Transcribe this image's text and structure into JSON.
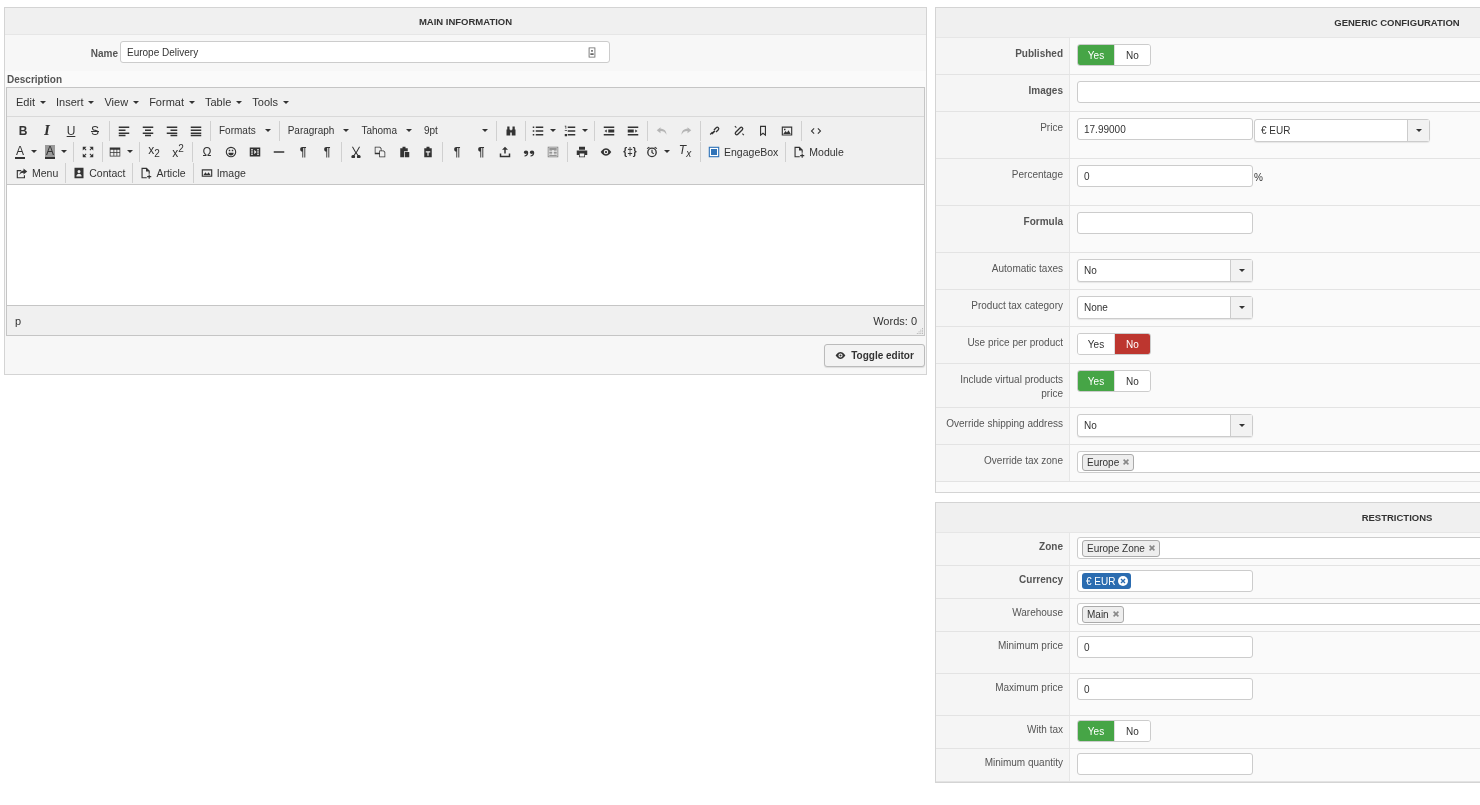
{
  "main": {
    "title": "MAIN INFORMATION",
    "name": {
      "label": "Name",
      "value": "Europe Delivery"
    },
    "description_label": "Description",
    "editor": {
      "menus": [
        "Edit",
        "Insert",
        "View",
        "Format",
        "Table",
        "Tools"
      ],
      "glyphs": [
        "B",
        "I",
        "U",
        "S",
        "A",
        "A",
        "x$_{2}$",
        "x$^{2}$",
        "Ω",
        "¶",
        "¶",
        "¶",
        "¶",
        "{‡}",
        "T$_{x}$"
      ],
      "dropdowns": [
        "Formats",
        "Paragraph",
        "Tahoma",
        "9pt"
      ],
      "buttons": [
        "EngageBox",
        "Module",
        "Menu",
        "Contact",
        "Article",
        "Image"
      ],
      "path": "p",
      "word_count": "Words: 0"
    },
    "toggle_button": "Toggle editor"
  },
  "generic": {
    "title": "GENERIC CONFIGURATION",
    "rows": [
      {
        "kind": "toggle",
        "label": "Published",
        "bold": true,
        "options": [
          {
            "label": "Yes",
            "selected": true
          },
          {
            "label": "No",
            "selected": false
          }
        ]
      },
      {
        "kind": "long_text",
        "label": "Images",
        "bold": true
      },
      {
        "kind": "price",
        "label": "Price",
        "bold": false,
        "value": "17.99000",
        "currency": "€ EUR"
      },
      {
        "kind": "text",
        "label": "Percentage",
        "bold": false,
        "value": "0",
        "suffix": "%"
      },
      {
        "kind": "text",
        "label": "Formula",
        "bold": true
      },
      {
        "kind": "select",
        "label": "Automatic taxes",
        "bold": false,
        "value": "No"
      },
      {
        "kind": "select",
        "label": "Product tax category",
        "bold": false,
        "value": "None"
      },
      {
        "kind": "toggle",
        "label": "Use price per product",
        "bold": false,
        "options": [
          {
            "label": "Yes",
            "selected": false
          },
          {
            "label": "No",
            "selected": true
          }
        ]
      },
      {
        "kind": "toggle",
        "label": "Include virtual products price",
        "bold": false,
        "options": [
          {
            "label": "Yes",
            "selected": true
          },
          {
            "label": "No",
            "selected": false
          }
        ]
      },
      {
        "kind": "select",
        "label": "Override shipping address",
        "bold": false,
        "value": "No"
      },
      {
        "kind": "tags",
        "label": "Override tax zone",
        "bold": false,
        "tags": [
          {
            "label": "Europe",
            "kind": "plain"
          }
        ]
      }
    ]
  },
  "restrictions": {
    "title": "RESTRICTIONS",
    "rows": [
      {
        "kind": "tags",
        "label": "Zone",
        "bold": true,
        "tags": [
          {
            "label": "Europe Zone",
            "kind": "plain"
          }
        ]
      },
      {
        "kind": "short_tags",
        "label": "Currency",
        "bold": true,
        "tags": [
          {
            "label": "€ EUR",
            "kind": "primary"
          }
        ]
      },
      {
        "kind": "tags",
        "label": "Warehouse",
        "bold": false,
        "tags": [
          {
            "label": "Main",
            "kind": "plain"
          }
        ]
      },
      {
        "kind": "text",
        "label": "Minimum price",
        "bold": false,
        "value": "0"
      },
      {
        "kind": "text",
        "label": "Maximum price",
        "bold": false,
        "value": "0"
      },
      {
        "kind": "toggle",
        "label": "With tax",
        "bold": false,
        "options": [
          {
            "label": "Yes",
            "selected": true
          },
          {
            "label": "No",
            "selected": false
          }
        ]
      },
      {
        "kind": "text",
        "label": "Minimum quantity",
        "bold": false
      }
    ]
  }
}
